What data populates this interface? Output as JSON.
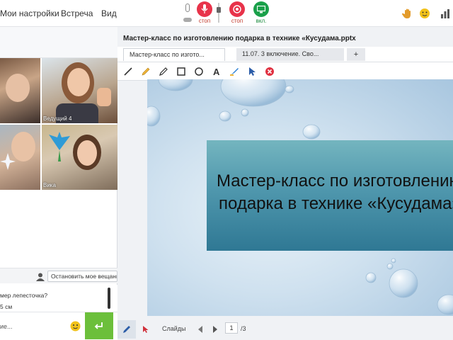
{
  "menu": {
    "settings": "Мои настройки",
    "meeting": "Встреча",
    "view": "Вид"
  },
  "controls": {
    "mic_label": "стоп",
    "cam_label": "стоп",
    "screen_label": "вкл."
  },
  "colors": {
    "stop": "#e8334a",
    "on": "#1aa04a",
    "send": "#6cbf3b",
    "banner": "#4f97ad"
  },
  "video": {
    "participants": [
      {
        "name": ""
      },
      {
        "name": "Ведущий 4"
      },
      {
        "name": ""
      },
      {
        "name": "Вика"
      }
    ],
    "stop_broadcast": "Остановить мое вещание"
  },
  "chat": {
    "messages": [
      "мер лепесточка?",
      "5 см"
    ],
    "input_text": "ие...",
    "send_icon": "enter-icon"
  },
  "presentation": {
    "title": "Мастер-класс по изготовлению подарка в технике «Кусудама.pptx",
    "tabs": [
      "Мастер-класс по изгото...",
      "11.07. 3 включение. Сво..."
    ],
    "add_tab": "+",
    "slide_line1": "Мастер-класс по изготовлению",
    "slide_line2": "подарка в технике «Кусудама»",
    "slides_label": "Слайды",
    "current_page": "1",
    "total_pages": "/3"
  },
  "tools": [
    "line-icon",
    "marker-icon",
    "pen-icon",
    "rectangle-icon",
    "circle-icon",
    "text-icon",
    "eraser-icon",
    "pointer-icon",
    "clear-icon"
  ]
}
